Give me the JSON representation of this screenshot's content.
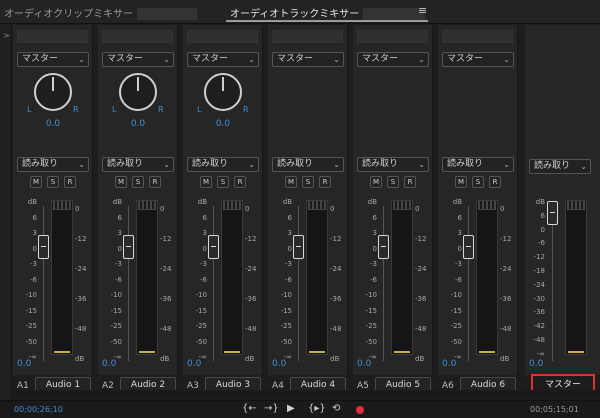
{
  "tabs": {
    "clip_mixer": "オーディオクリップミキサー",
    "track_mixer": "オーディオトラックミキサー",
    "menu_icon": "≡"
  },
  "strips": [
    {
      "id": "A1",
      "name": "Audio 1",
      "send": "マスター",
      "automation": "読み取り",
      "pan": "0.0",
      "volume": "0.0",
      "has_pan": true
    },
    {
      "id": "A2",
      "name": "Audio 2",
      "send": "マスター",
      "automation": "読み取り",
      "pan": "0.0",
      "volume": "0.0",
      "has_pan": true
    },
    {
      "id": "A3",
      "name": "Audio 3",
      "send": "マスター",
      "automation": "読み取り",
      "pan": "0.0",
      "volume": "0.0",
      "has_pan": true
    },
    {
      "id": "A4",
      "name": "Audio 4",
      "send": "マスター",
      "automation": "読み取り",
      "pan": "",
      "volume": "0.0",
      "has_pan": false
    },
    {
      "id": "A5",
      "name": "Audio 5",
      "send": "マスター",
      "automation": "読み取り",
      "pan": "",
      "volume": "0.0",
      "has_pan": false
    },
    {
      "id": "A6",
      "name": "Audio 6",
      "send": "マスター",
      "automation": "読み取り",
      "pan": "",
      "volume": "0.0",
      "has_pan": false
    }
  ],
  "master": {
    "name": "マスター",
    "automation": "読み取り",
    "volume": "0.0"
  },
  "labels": {
    "L": "L",
    "R": "R",
    "M": "M",
    "S": "S",
    "Rb": "R"
  },
  "fader_scale": [
    "dB",
    "6",
    "3",
    "0",
    "-3",
    "-6",
    "-10",
    "-15",
    "-25",
    "-50",
    "-∞"
  ],
  "meter_scale": [
    "0",
    "-12",
    "-24",
    "-36",
    "-48",
    "dB"
  ],
  "master_fader_scale": [
    "dB",
    "6",
    "0",
    "-6",
    "-12",
    "-18",
    "-24",
    "-30",
    "-36",
    "-42",
    "-48",
    "-∞"
  ],
  "timecode": {
    "current": "00;00;26;10",
    "duration": "00;05;15;01"
  },
  "transport_icons": [
    "go-to-in-icon",
    "go-to-out-icon",
    "play-icon",
    "loop-icon",
    "record-icon"
  ],
  "colors": {
    "accent": "#3f8fd8",
    "highlight": "#e03030"
  }
}
